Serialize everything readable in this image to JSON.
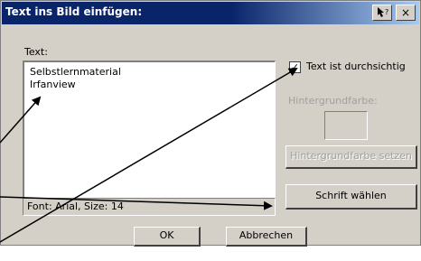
{
  "window": {
    "title": "Text ins Bild einfügen:",
    "help_icon": "context-help-icon",
    "close_label": "×"
  },
  "text_section": {
    "label": "Text:",
    "lines": [
      "Selbstlernmaterial",
      "Irfanview"
    ]
  },
  "font_info": "Font: Arial, Size: 14",
  "transparent_checkbox": {
    "label": "Text ist durchsichtig",
    "checked": true,
    "check_glyph": "✓"
  },
  "background_color": {
    "label": "Hintergrundfarbe:",
    "set_button": "Hintergrundfarbe setzen"
  },
  "choose_font_button": "Schrift wählen",
  "buttons": {
    "ok": "OK",
    "cancel": "Abbrechen"
  },
  "colors": {
    "title_bar": "#0a246a",
    "dialog_face": "#d4d0c8",
    "annotation_arrow": "#000000"
  }
}
